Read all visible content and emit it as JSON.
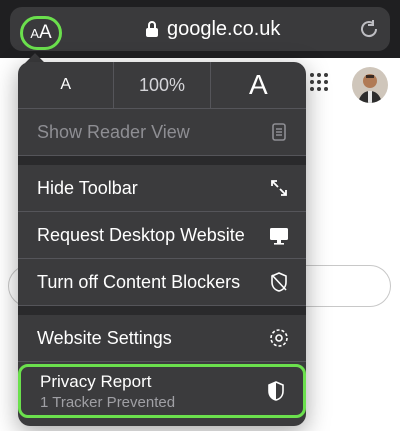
{
  "address_bar": {
    "aa_small": "A",
    "aa_big": "A",
    "url": "google.co.uk",
    "accent": "#6be04d"
  },
  "menu": {
    "font_small": "A",
    "zoom": "100%",
    "font_large": "A",
    "reader_view": {
      "label": "Show Reader View",
      "icon": "document-icon"
    },
    "items": [
      {
        "label": "Hide Toolbar",
        "icon": "arrows-expand-icon"
      },
      {
        "label": "Request Desktop Website",
        "icon": "monitor-icon"
      },
      {
        "label": "Turn off Content Blockers",
        "icon": "shield-slash-icon"
      }
    ],
    "website_settings": {
      "label": "Website Settings",
      "icon": "gear-icon"
    },
    "privacy": {
      "title": "Privacy Report",
      "subtitle": "1 Tracker Prevented",
      "icon": "shield-half-icon"
    }
  }
}
